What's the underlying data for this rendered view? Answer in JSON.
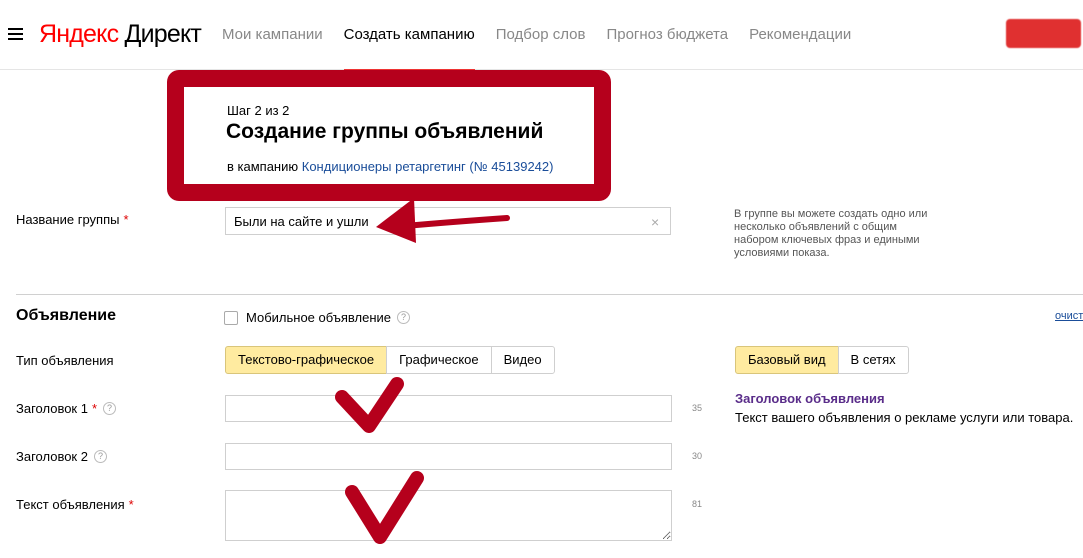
{
  "header": {
    "logo_brand": "Яндекс",
    "logo_product": "Директ",
    "nav": [
      {
        "label": "Мои кампании",
        "active": false
      },
      {
        "label": "Создать кампанию",
        "active": true
      },
      {
        "label": "Подбор слов",
        "active": false
      },
      {
        "label": "Прогноз бюджета",
        "active": false
      },
      {
        "label": "Рекомендации",
        "active": false
      }
    ]
  },
  "step": {
    "label": "Шаг 2 из 2",
    "title": "Создание группы объявлений",
    "campaign_prefix": "в кампанию",
    "campaign_link": "Кондиционеры ретаргетинг (№ 45139242)"
  },
  "group_name": {
    "label": "Название группы",
    "required_mark": "*",
    "value": "Были на сайте и ушли",
    "clear_icon": "×",
    "hint": "В группе вы можете создать одно или несколько объявлений с общим набором ключевых фраз и едиными условиями показа."
  },
  "ad_section": {
    "title": "Объявление",
    "mobile_label": "Мобильное объявление",
    "mobile_checked": false,
    "help_icon": "?",
    "clear_link": "очист"
  },
  "ad_type": {
    "label": "Тип объявления",
    "options": [
      "Текстово-графическое",
      "Графическое",
      "Видео"
    ],
    "selected_index": 0
  },
  "preview_toggle": {
    "options": [
      "Базовый вид",
      "В сетях"
    ],
    "selected_index": 0
  },
  "fields": {
    "title1": {
      "label": "Заголовок 1",
      "required_mark": "*",
      "counter": "35",
      "value": ""
    },
    "title2": {
      "label": "Заголовок 2",
      "counter": "30",
      "value": ""
    },
    "text": {
      "label": "Текст объявления",
      "required_mark": "*",
      "counter": "81",
      "value": ""
    }
  },
  "preview": {
    "title": "Заголовок объявления",
    "text": "Текст вашего объявления о рекламе услуги или товара."
  },
  "colors": {
    "annotation": "#b5001c",
    "accent": "#e33333",
    "selected_segment": "#ffeba0",
    "link": "#1a4d99",
    "preview_title": "#5a2d8a"
  }
}
